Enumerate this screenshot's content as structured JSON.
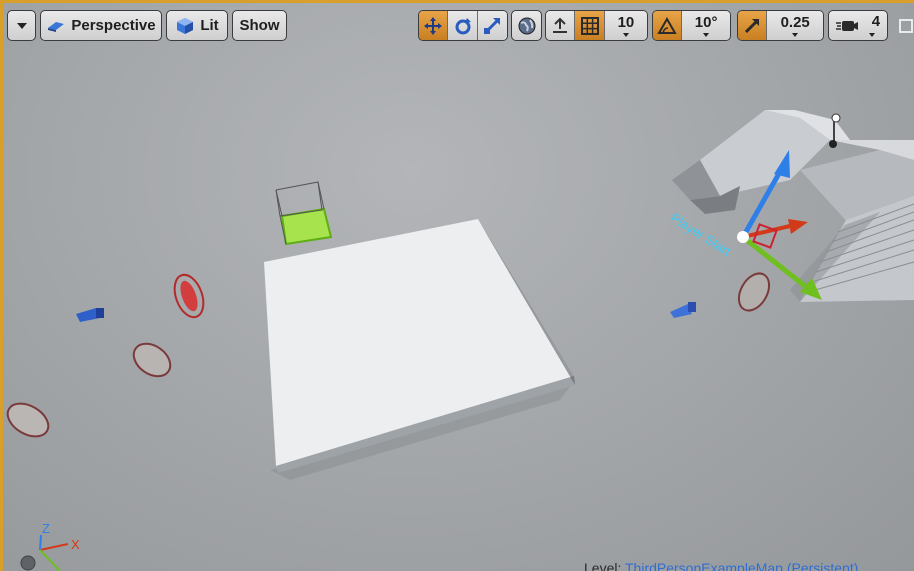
{
  "toolbar": {
    "view_mode": "Perspective",
    "lighting_mode": "Lit",
    "show_label": "Show",
    "grid_snap_value": "10",
    "rotation_snap_value": "10°",
    "scale_snap_value": "0.25",
    "camera_speed_value": "4"
  },
  "viewport": {
    "axis_z": "Z",
    "axis_x": "X",
    "player_start_label": "Player Start",
    "level_prefix": "Level: ",
    "level_name": "ThirdPersonExampleMap (Persistent)"
  },
  "colors": {
    "frame_accent": "#d8a02a",
    "active_button": "#d9922f",
    "gizmo_x": "#d33a1a",
    "gizmo_y": "#6fbf1f",
    "gizmo_z": "#2f7fe8",
    "selection_green": "#9be043"
  },
  "icons": [
    "dropdown-icon",
    "perspective-icon",
    "lit-sphere-icon",
    "translate-icon",
    "rotate-icon",
    "scale-icon",
    "world-space-icon",
    "surface-snap-icon",
    "grid-icon",
    "angle-icon",
    "scale-snap-icon",
    "camera-speed-icon",
    "maximize-icon"
  ]
}
